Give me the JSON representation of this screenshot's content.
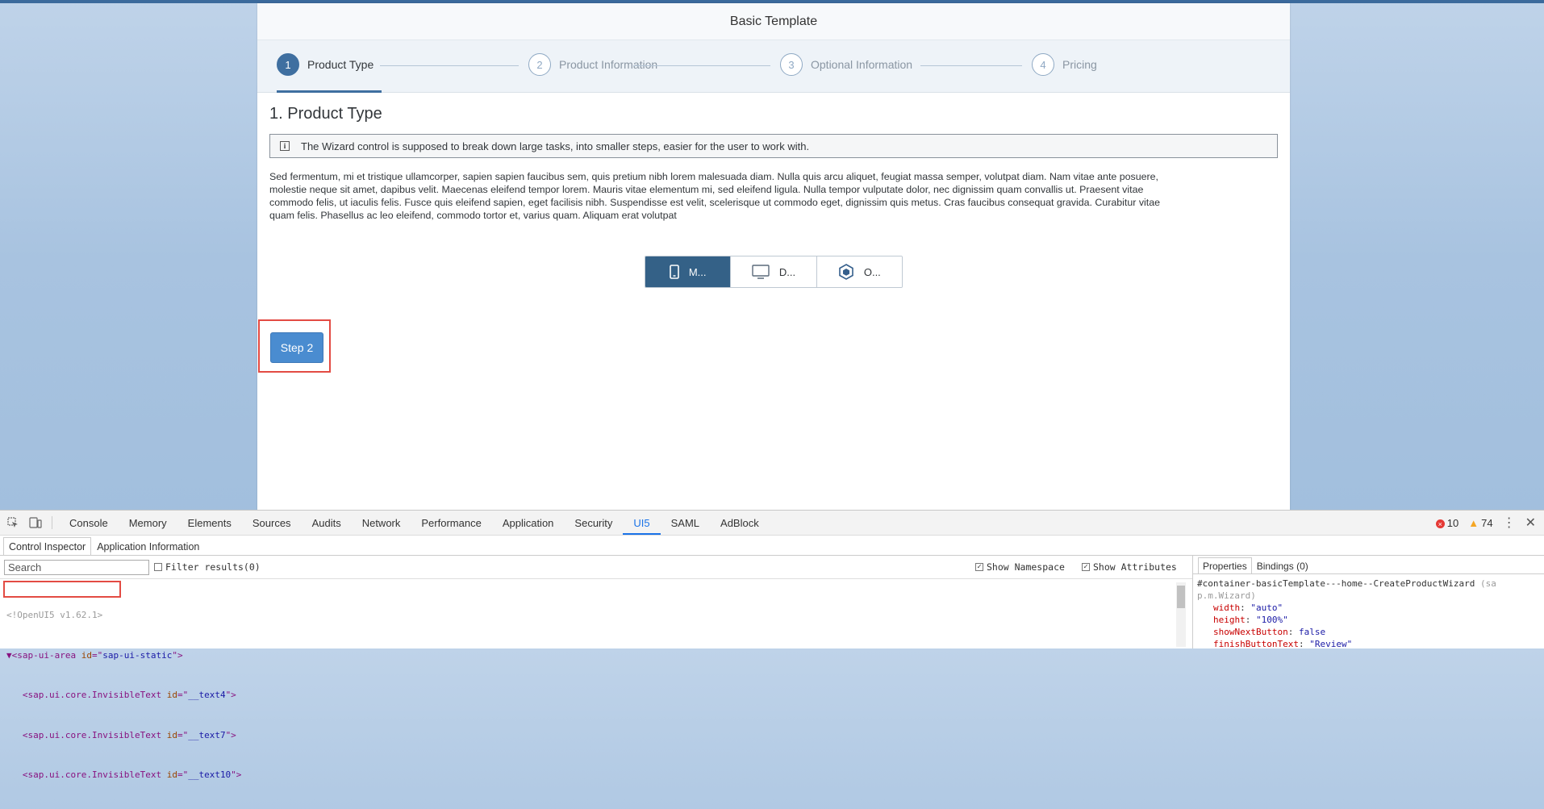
{
  "app": {
    "title": "Basic Template"
  },
  "wizard": {
    "steps": [
      {
        "number": "1",
        "label": "Product Type"
      },
      {
        "number": "2",
        "label": "Product Information"
      },
      {
        "number": "3",
        "label": "Optional Information"
      },
      {
        "number": "4",
        "label": "Pricing"
      }
    ],
    "current_step_index": 0
  },
  "content": {
    "title": "1. Product Type",
    "info_strip": "The Wizard control is supposed to break down large tasks, into smaller steps, easier for the user to work with.",
    "lorem_lines": [
      "Sed fermentum, mi et tristique ullamcorper, sapien sapien faucibus sem, quis pretium nibh lorem malesuada diam. Nulla quis arcu aliquet, feugiat massa semper, volutpat diam. Nam vitae ante posuere,",
      "molestie neque sit amet, dapibus velit. Maecenas eleifend tempor lorem. Mauris vitae elementum mi, sed eleifend ligula. Nulla tempor vulputate dolor, nec dignissim quam convallis ut. Praesent vitae",
      "commodo felis, ut iaculis felis. Fusce quis eleifend sapien, eget facilisis nibh. Suspendisse est velit, scelerisque ut commodo eget, dignissim quis metus. Cras faucibus consequat gravida. Curabitur vitae",
      "quam felis. Phasellus ac leo eleifend, commodo tortor et, varius quam. Aliquam erat volutpat"
    ],
    "segmented": [
      {
        "label": "M...",
        "icon": "phone-icon",
        "selected": true
      },
      {
        "label": "D...",
        "icon": "monitor-icon",
        "selected": false
      },
      {
        "label": "O...",
        "icon": "cube-icon",
        "selected": false
      }
    ],
    "step_button": "Step 2"
  },
  "devtools": {
    "tabs": [
      "Console",
      "Memory",
      "Elements",
      "Sources",
      "Audits",
      "Network",
      "Performance",
      "Application",
      "Security",
      "UI5",
      "SAML",
      "AdBlock"
    ],
    "active_tab": "UI5",
    "error_count": "10",
    "warning_count": "74",
    "sub_tabs": [
      "Control Inspector",
      "Application Information"
    ],
    "search_placeholder": "Search",
    "filter_label": "Filter results(0)",
    "show_namespace": "Show Namespace",
    "show_attributes": "Show Attributes",
    "tree": {
      "comment": "<!OpenUI5 v1.62.1>",
      "root_tag": "sap-ui-area",
      "root_attr": "id",
      "root_val": "sap-ui-static",
      "rows": [
        {
          "tag": "sap.ui.core.InvisibleText",
          "attr": "id",
          "val": "__text4"
        },
        {
          "tag": "sap.ui.core.InvisibleText",
          "attr": "id",
          "val": "__text7"
        },
        {
          "tag": "sap.ui.core.InvisibleText",
          "attr": "id",
          "val": "__text10"
        }
      ]
    },
    "props_tabs": [
      "Properties",
      "Bindings (0)"
    ],
    "props": {
      "control_id": "#container-basicTemplate---home--CreateProductWizard",
      "control_type_a": "(sa",
      "control_type_b": "p.m.Wizard)",
      "items": [
        {
          "key": "width",
          "value": "\"auto\""
        },
        {
          "key": "height",
          "value": "\"100%\""
        },
        {
          "key": "showNextButton",
          "value": "false"
        },
        {
          "key": "finishButtonText",
          "value": "\"Review\""
        }
      ]
    }
  },
  "colors": {
    "accent": "#3f6fa0",
    "button": "#4a8cd0",
    "highlight": "#e34b43"
  }
}
